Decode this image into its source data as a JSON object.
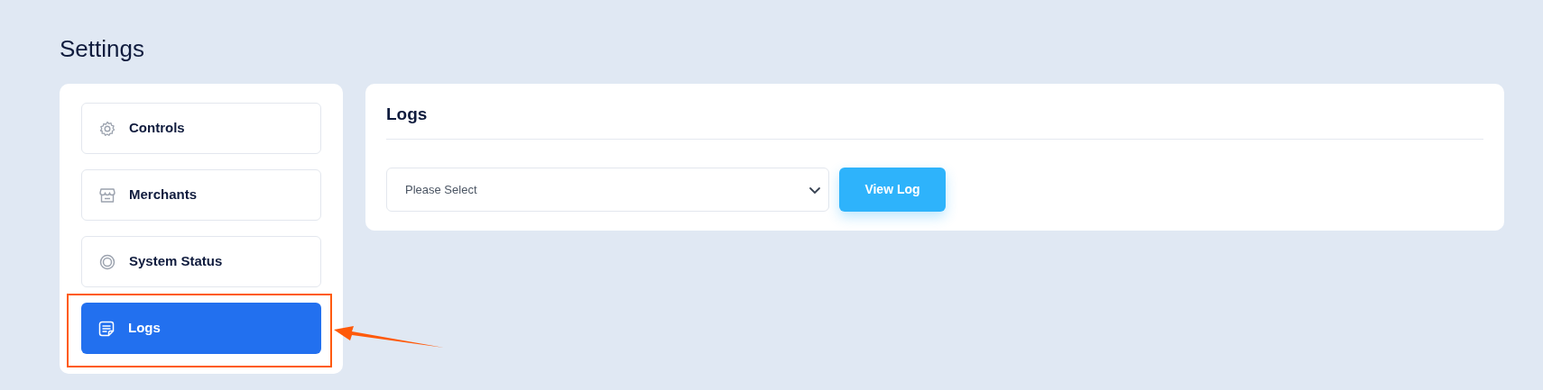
{
  "page_title": "Settings",
  "sidebar": {
    "items": [
      {
        "label": "Controls",
        "kind": "gear",
        "selected": false
      },
      {
        "label": "Merchants",
        "kind": "store",
        "selected": false
      },
      {
        "label": "System Status",
        "kind": "ring",
        "selected": false
      },
      {
        "label": "Logs",
        "kind": "document",
        "selected": true
      }
    ]
  },
  "panel": {
    "title": "Logs",
    "select": {
      "placeholder": "Please Select"
    },
    "button": "View Log"
  }
}
